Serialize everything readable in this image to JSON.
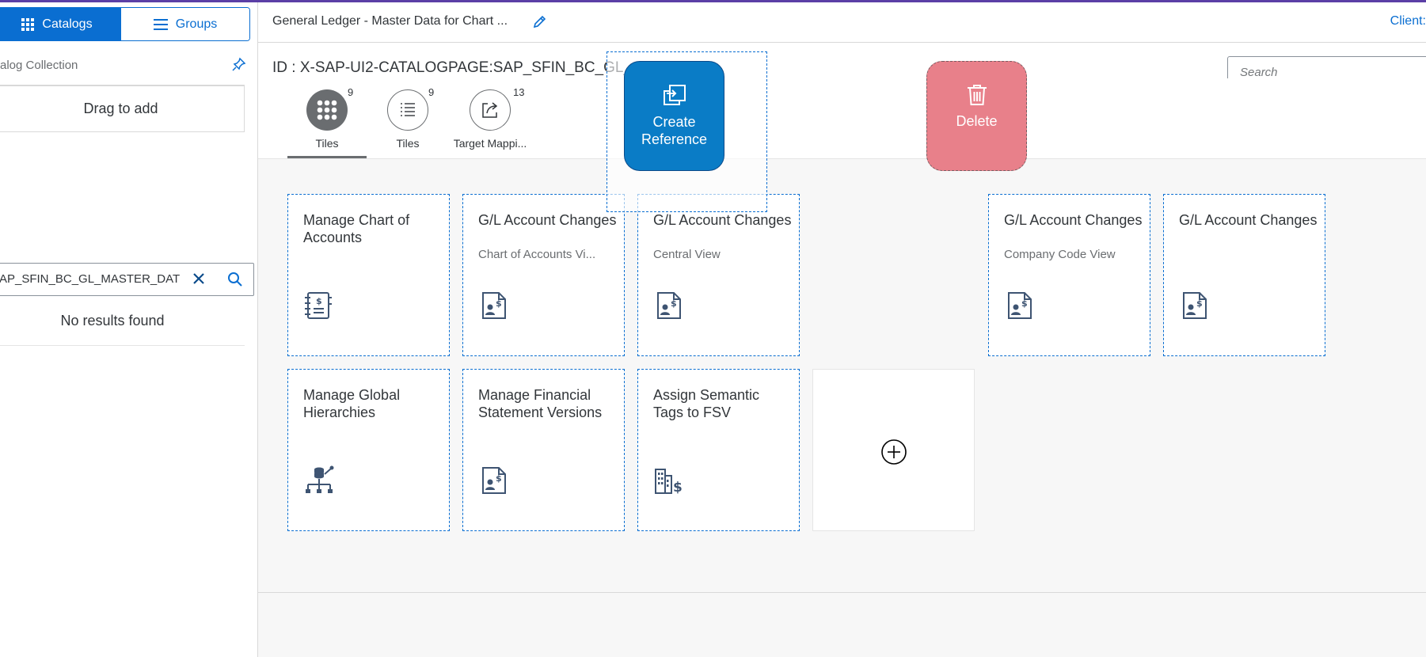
{
  "sidebar": {
    "tab_catalogs": "Catalogs",
    "tab_groups": "Groups",
    "collection_title": "alog Collection",
    "drag_to_add": "Drag to add",
    "search_value": "AP_SFIN_BC_GL_MASTER_DAT",
    "no_results": "No results found"
  },
  "header": {
    "title": "General Ledger - Master Data for Chart ...",
    "client": "Client:"
  },
  "page": {
    "id_label": "ID : X-SAP-UI2-CATALOGPAGE:SAP_SFIN_BC_GL_",
    "search_placeholder": "Search"
  },
  "tabs": [
    {
      "label": "Tiles",
      "count": "9",
      "icon": "grid-icon"
    },
    {
      "label": "Tiles",
      "count": "9",
      "icon": "list-icon"
    },
    {
      "label": "Target Mappi...",
      "count": "13",
      "icon": "share-icon"
    }
  ],
  "drag_targets": {
    "create_reference": "Create Reference",
    "delete": "Delete"
  },
  "tiles": [
    {
      "title": "Manage Chart of Accounts",
      "subtitle": "",
      "icon": "ledger-icon"
    },
    {
      "title": "G/L Account Changes",
      "subtitle": "Chart of Accounts Vi...",
      "icon": "account-doc-icon"
    },
    {
      "title": "G/L Account Changes",
      "subtitle": "Central View",
      "icon": "account-doc-icon"
    },
    {
      "title": "G/L Account Changes",
      "subtitle": "Company Code View",
      "icon": "account-doc-icon"
    },
    {
      "title": "G/L Account Changes",
      "subtitle": "",
      "icon": "account-doc-icon"
    },
    {
      "title": "Manage Global Hierarchies",
      "subtitle": "",
      "icon": "hierarchy-icon"
    },
    {
      "title": "Manage Financial Statement Versions",
      "subtitle": "",
      "icon": "account-doc-icon"
    },
    {
      "title": "Assign Semantic Tags to FSV",
      "subtitle": "",
      "icon": "building-dollar-icon"
    }
  ],
  "colors": {
    "brand": "#0a6ed1",
    "create_reference": "#0a7cc6",
    "delete": "#e8808a"
  }
}
